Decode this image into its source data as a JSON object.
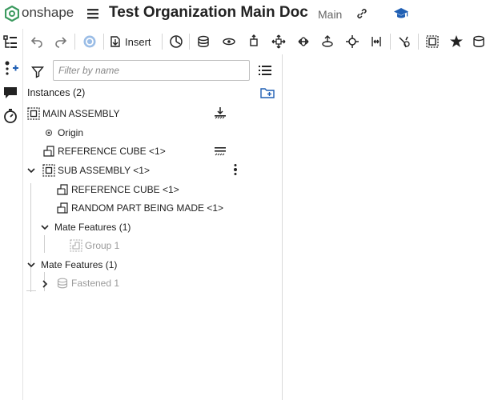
{
  "brand": {
    "logo_text": "onshape",
    "accent": "#3c9a5f"
  },
  "document": {
    "title": "Test Organization Main Doc",
    "branch": "Main"
  },
  "toolbar": {
    "insert_label": "Insert",
    "icons": [
      "undo-icon",
      "redo-icon",
      "refresh-icon",
      "insert-icon",
      "mate-connector-icon",
      "fastened-mate-icon",
      "revolute-mate-icon",
      "slider-mate-icon",
      "planar-mate-icon",
      "cylindrical-mate-icon",
      "pin-slot-mate-icon",
      "ball-mate-icon",
      "parallel-mate-icon",
      "tangent-mate-icon",
      "group-icon",
      "replicate-icon",
      "pattern-icon"
    ]
  },
  "panel": {
    "filter_placeholder": "Filter by name",
    "instances_label": "Instances (2)",
    "tree": {
      "main_assembly": "MAIN ASSEMBLY",
      "origin": "Origin",
      "reference_cube": "REFERENCE CUBE <1>",
      "sub_assembly": "SUB ASSEMBLY <1>",
      "sub_reference_cube": "REFERENCE CUBE <1>",
      "random_part": "RANDOM PART BEING MADE <1>",
      "sub_mate_features": "Mate Features (1)",
      "group": "Group 1",
      "mate_features": "Mate Features (1)",
      "fastened": "Fastened 1"
    }
  }
}
